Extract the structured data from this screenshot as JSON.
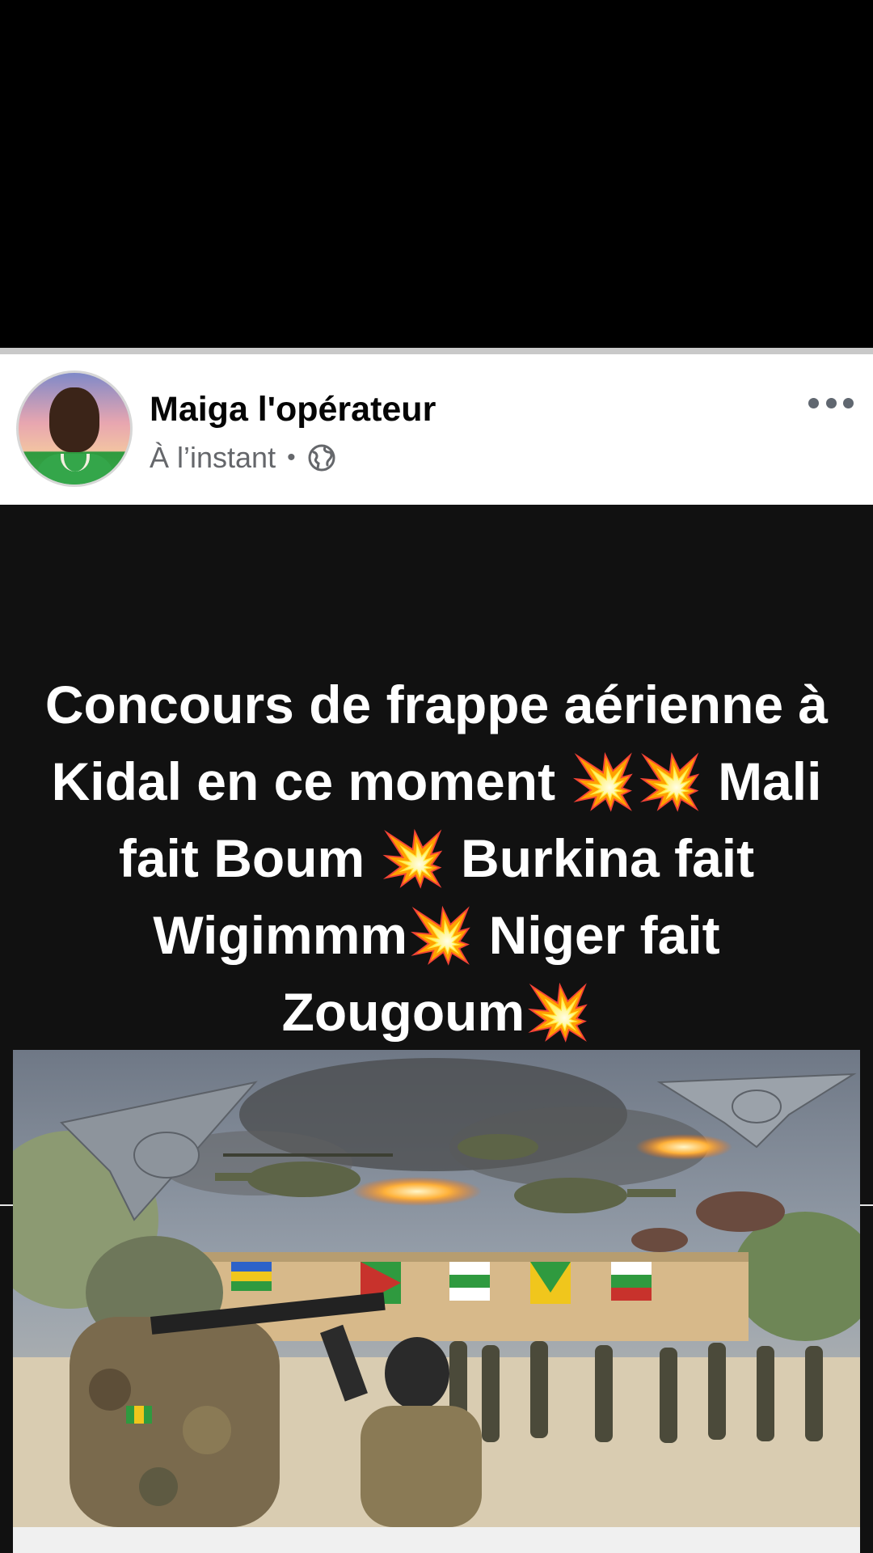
{
  "post": {
    "author": "Maiga l'opérateur",
    "timestamp": "À l’instant",
    "separator": "•",
    "audience_icon": "globe-icon",
    "more_icon": "more-horizontal-icon",
    "text_lines": [
      "Concours de frappe aérienne à",
      "Kidal en ce moment 💥💥 Mali",
      "fait Boum 💥 Burkina fait",
      "Wigimmm💥 Niger fait",
      "Zougoum💥"
    ]
  },
  "image": {
    "flags": [
      {
        "colors": [
          "#2d62c9",
          "#f0c61c",
          "#2f9a3f"
        ]
      },
      {
        "colors": [
          "#2f9a3f",
          "#f0c61c",
          "#c8322c"
        ]
      },
      {
        "colors": [
          "#ffffff",
          "#2f9a3f",
          "#000000"
        ]
      },
      {
        "colors": [
          "#2f9a3f",
          "#f0c61c",
          "#c8322c"
        ]
      },
      {
        "colors": [
          "#c8322c",
          "#f0c61c",
          "#2f9a3f"
        ]
      }
    ]
  },
  "colors": {
    "background": "#000000",
    "header_bg": "#ffffff",
    "post_bg": "#111111",
    "author_text": "#050505",
    "meta_text": "#65676b",
    "post_text": "#ffffff"
  }
}
